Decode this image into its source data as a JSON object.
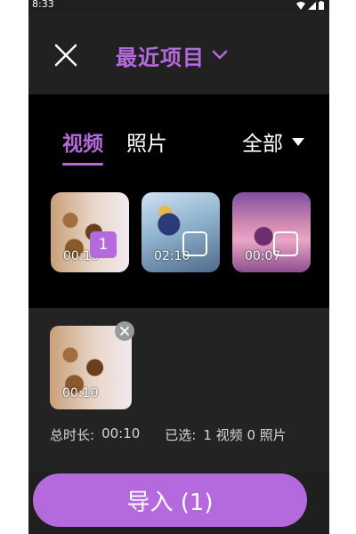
{
  "status_bar": {
    "time": "8:33"
  },
  "header": {
    "title": "最近项目",
    "close_icon": "close-icon",
    "dropdown_icon": "chevron-down-icon"
  },
  "tabs": [
    {
      "label": "视频",
      "active": true
    },
    {
      "label": "照片",
      "active": false
    }
  ],
  "filter": {
    "label": "全部"
  },
  "media": [
    {
      "duration": "00:10",
      "selected_index": "1"
    },
    {
      "duration": "02:10",
      "selected_index": ""
    },
    {
      "duration": "00:07",
      "selected_index": ""
    }
  ],
  "selected": {
    "items": [
      {
        "duration": "00:10"
      }
    ],
    "total_label": "总时长:",
    "total_value": "00:10",
    "selected_label": "已选:",
    "selected_count": "1 视频 0 照片"
  },
  "import_button": {
    "label": "导入 (1)"
  },
  "colors": {
    "accent": "#b46adc",
    "background": "#1f1f1f",
    "gallery_bg": "#000000"
  }
}
